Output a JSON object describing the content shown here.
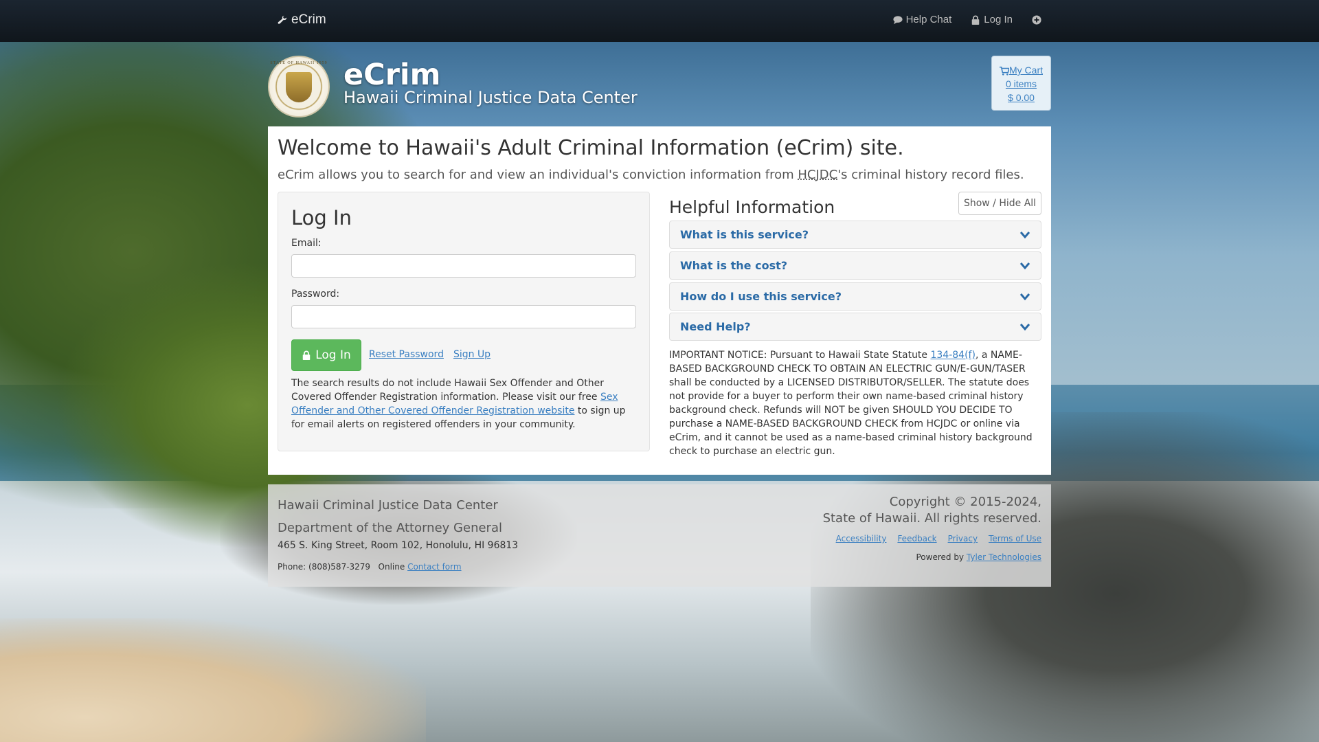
{
  "navbar": {
    "brand": "eCrim",
    "help_chat": "Help Chat",
    "log_in": "Log In"
  },
  "header": {
    "title": "eCrim",
    "subtitle": "Hawaii Criminal Justice Data Center",
    "seal_text": "STATE OF HAWAII 1959"
  },
  "cart": {
    "label": "My Cart",
    "items": "0 items",
    "total": "$ 0.00"
  },
  "main": {
    "welcome": "Welcome to Hawaii's Adult Criminal Information (eCrim) site.",
    "lead_before": "eCrim allows you to search for and view an individual's conviction information from ",
    "lead_abbr": "HCJDC",
    "lead_after": "'s criminal history record files."
  },
  "login": {
    "heading": "Log In",
    "email_label": "Email:",
    "email_value": "",
    "password_label": "Password:",
    "password_value": "",
    "submit": "Log In",
    "reset_password": "Reset Password",
    "sign_up": "Sign Up",
    "note_before": "The search results do not include Hawaii Sex Offender and Other Covered Offender Registration information. Please visit our free ",
    "note_link": "Sex Offender and Other Covered Offender Registration website",
    "note_after": " to sign up for email alerts on registered offenders in your community."
  },
  "helpful": {
    "heading": "Helpful Information",
    "toggle_all": "Show / Hide All",
    "sections": [
      {
        "title": "What is this service?"
      },
      {
        "title": "What is the cost?"
      },
      {
        "title": "How do I use this service?"
      },
      {
        "title": "Need Help?"
      }
    ],
    "notice_before": "IMPORTANT NOTICE: Pursuant to Hawaii State Statute ",
    "notice_link": "134-84(f)",
    "notice_after": ", a NAME-BASED BACKGROUND CHECK TO OBTAIN AN ELECTRIC GUN/E-GUN/TASER shall be conducted by a LICENSED DISTRIBUTOR/SELLER. The statute does not provide for a buyer to perform their own name-based criminal history background check. Refunds will NOT be given SHOULD YOU DECIDE TO purchase a NAME-BASED BACKGROUND CHECK from HCJDC or online via eCrim, and it cannot be used as a name-based criminal history background check to purchase an electric gun."
  },
  "footer": {
    "org_line1": "Hawaii Criminal Justice Data Center",
    "org_line2": "Department of the Attorney General",
    "address": "465 S. King Street, Room 102, Honolulu, HI 96813",
    "phone": "Phone: (808)587-3279",
    "online_label": "Online",
    "contact_link": "Contact form",
    "copyright_line1": "Copyright © 2015-2024,",
    "copyright_line2": "State of Hawaii. All rights reserved.",
    "links": [
      "Accessibility",
      "Feedback",
      "Privacy",
      "Terms of Use"
    ],
    "powered_by": "Powered by",
    "powered_link": "Tyler Technologies"
  },
  "icons": {
    "brand": "wrench-icon",
    "help_chat": "comment-icon",
    "log_in": "lock-icon",
    "nav_plus": "plus-circle-icon",
    "cart": "cart-icon",
    "login_button": "lock-icon",
    "accordion": "chevron-down-icon"
  },
  "colors": {
    "accent_link": "#3a7fc1",
    "accordion_title": "#2a6aa6",
    "login_button": "#5cb85c",
    "navbar": "#10161c"
  }
}
